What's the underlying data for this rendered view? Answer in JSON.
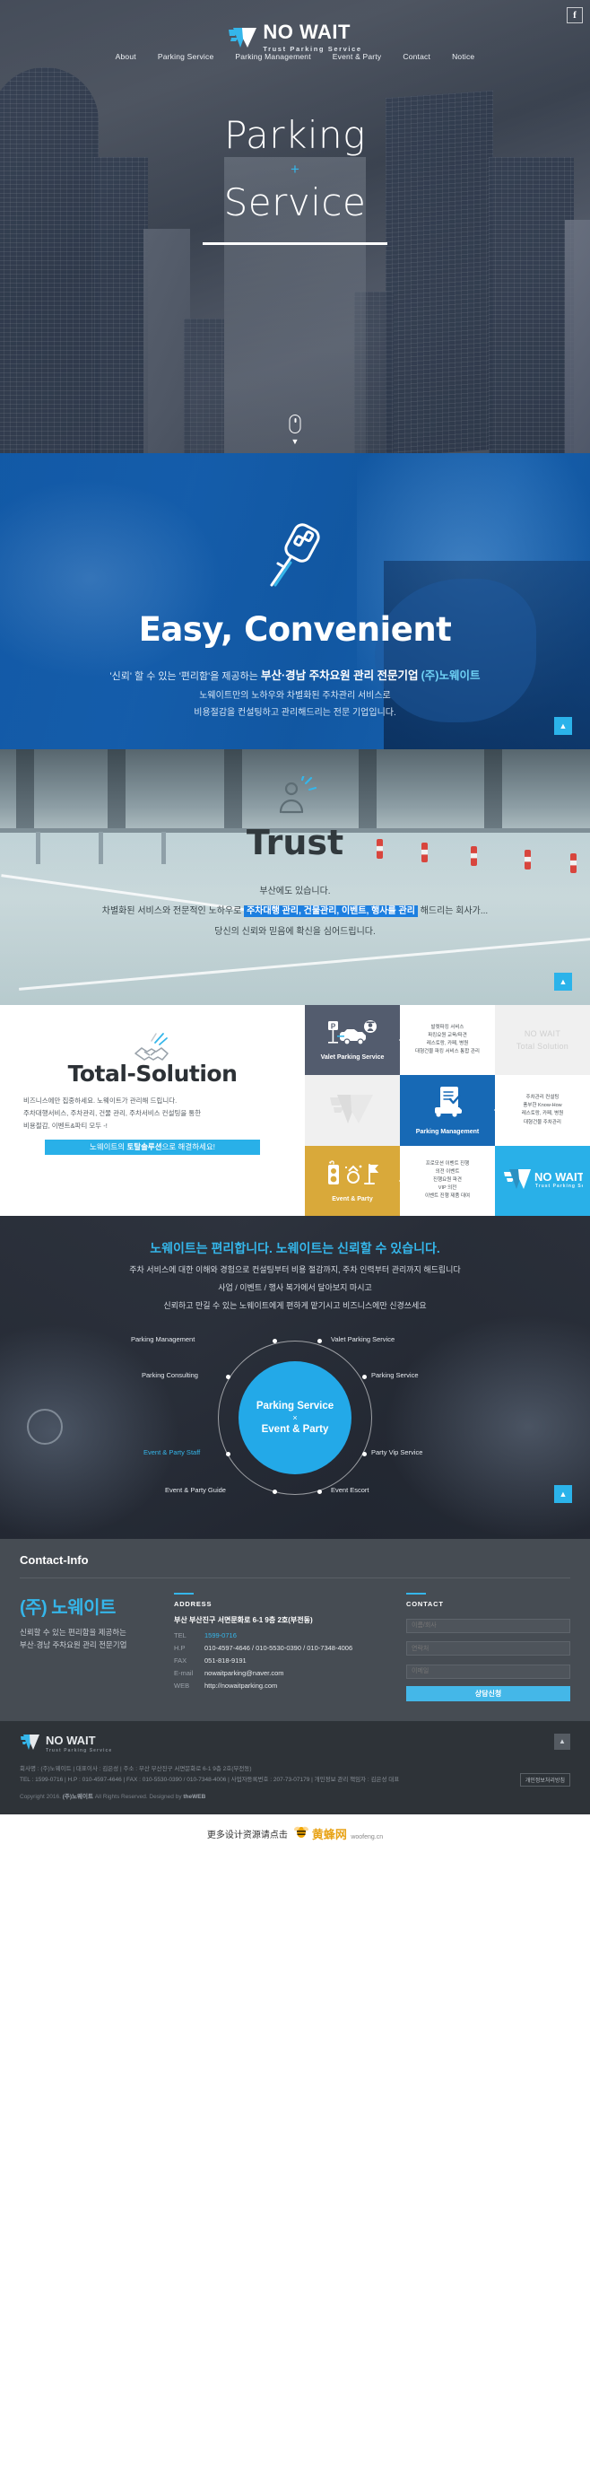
{
  "brand": {
    "name": "NO WAIT",
    "tagline": "Trust Parking Service",
    "facebook_icon": "f"
  },
  "nav": {
    "items": [
      {
        "label": "About"
      },
      {
        "label": "Parking Service"
      },
      {
        "label": "Parking Management"
      },
      {
        "label": "Event & Party"
      },
      {
        "label": "Contact"
      },
      {
        "label": "Notice"
      }
    ]
  },
  "hero": {
    "line1": "Parking",
    "plus": "+",
    "line2": "Service",
    "scroll_hint": "▼"
  },
  "easy": {
    "heading": "Easy, Convenient",
    "lead_prefix": "'신뢰' 할 수 있는 '편리함'을 제공하는 ",
    "lead_bold": "부산·경남 주차요원 관리 전문기업",
    "lead_cyan": "(주)노웨이트",
    "p1": "노웨이트만의 노하우와 차별화된 주차관리 서비스로",
    "p2": "비용절감을 컨설팅하고 관리해드리는 전문 기업입니다.",
    "scroll_top": "▲"
  },
  "trust": {
    "heading": "Trust",
    "l1": "부산에도 있습니다.",
    "l2_pre": "차별화된 서비스와 전문적인 노하우로 ",
    "l2_hl": "주차대행 관리, 건물관리, 이벤트, 행사를 관리",
    "l2_post": " 해드리는 회사가...",
    "l3": "당신의 신뢰와 믿음에 확신을 심어드립니다.",
    "scroll_top": "▲"
  },
  "total_solution": {
    "heading_a": "Total",
    "heading_dash": "-",
    "heading_b": "Solution",
    "p1": "비즈니스에만 집중하세요. 노웨이트가 관리해 드립니다.",
    "p2": "주차대행서비스, 주차관리, 건물 관리, 주차서비스 컨설팅을 통한",
    "p3": "비용절감, 이벤트&파티 모두 -!",
    "cta_pre": "노웨이트의 ",
    "cta_bold": "토탈솔루션",
    "cta_post": "으로 해결하세요!",
    "cells": {
      "valet_label": "Valet Parking Service",
      "valet_desc": [
        "발렛파킹 서비스",
        "파킹요원 교육/파견",
        "레스토랑, 카페, 병원",
        "대형건물 파킹 서비스 통합 관리"
      ],
      "watermark_a": "NO WAIT",
      "watermark_b": "Total  Solution",
      "pm_label": "Parking Management",
      "pm_desc": [
        "주차관리 컨설팅",
        "풍부한 Know-How",
        "레스토랑, 카페, 병원",
        "대형건물 주차관리"
      ],
      "ep_label": "Event & Party",
      "ep_desc": [
        "프로모션 이벤트 진행",
        "의전 이벤트",
        "진행요원 파견",
        "VIP 의전",
        "이벤트 진행 제품 대여"
      ]
    }
  },
  "diagram": {
    "heading": "노웨이트는 편리합니다. 노웨이트는 신뢰할 수 있습니다.",
    "p1": "주차 서비스에 대한 이해와 경험으로 컨설팅부터 비용 절감까지, 주차 인력부터 관리까지 해드립니다",
    "p2": "사업 / 이벤트 / 행사 복가에서 달아보지 마시고",
    "p3": "신뢰하고 만길 수 있는 노웨이트에게 편하게 맡기시고 비즈니스에만 신경쓰세요",
    "core_top": "Parking Service",
    "core_x": "×",
    "core_bottom": "Event & Party",
    "nodes": [
      {
        "label": "Parking Management"
      },
      {
        "label": "Valet Parking Service"
      },
      {
        "label": "Parking Service"
      },
      {
        "label": "Party Vip Service"
      },
      {
        "label": "Event Escort"
      },
      {
        "label": "Event & Party Guide"
      },
      {
        "label": "Event & Party Staff"
      },
      {
        "label": "Parking Consulting"
      }
    ],
    "scroll_top": "▲"
  },
  "contact": {
    "title": "Contact-Info",
    "brand_name": "(주) 노웨이트",
    "brand_p1": "신뢰할 수 있는 편리함을 제공하는",
    "brand_p2": "부산·경남 주차요원 관리 전문기업",
    "address_caption": "ADDRESS",
    "address": "부산 부산진구 서면문화로 6-1 9층 2호(부전동)",
    "rows": [
      {
        "key": "TEL",
        "value": "1599-0716",
        "accent": true
      },
      {
        "key": "H.P",
        "value": "010-4597-4646 / 010-5530-0390 / 010-7348-4006",
        "accent": false
      },
      {
        "key": "FAX",
        "value": "051-818-9191",
        "accent": false
      },
      {
        "key": "E-mail",
        "value": "nowaitparking@naver.com",
        "accent": false
      },
      {
        "key": "WEB",
        "value": "http://nowaitparking.com",
        "accent": false
      }
    ],
    "contact_caption": "CONTACT",
    "fields": [
      {
        "placeholder": "이름/회사",
        "value": ""
      },
      {
        "placeholder": "연락처",
        "value": ""
      },
      {
        "placeholder": "이메일",
        "value": ""
      }
    ],
    "submit_label": "상담신청"
  },
  "footer": {
    "logo_name": "NO WAIT",
    "logo_sub": "Trust Parking Service",
    "line1": "회사명 : (주)노웨이트  |  대표이사 : 김은성  |  주소 : 부산 부산진구 서면문화로 6-1 9층 2호(부전동)",
    "line2": "TEL : 1599-0716  |  H.P : 010-4597-4646  |  FAX : 010-5530-0390 / 010-7348-4006  |  사업자등록번호 : 207-73-07179  |  개인정보 관리 책임자 : 김은성 대표",
    "copyright_pre": "Copyright 2016. ",
    "copyright_bold": "(주)노웨이트",
    "copyright_post": " All Rights Reserved. Designed by ",
    "copyright_brand": "theWEB",
    "privacy_label": "개인정보처리방침",
    "to_top": "▲"
  },
  "banner": {
    "text": "更多设计资源请点击",
    "brand": "黄蜂网",
    "url": "woofeng.cn"
  },
  "colors": {
    "cyan": "#35b6ea",
    "blue": "#1769b5",
    "dark_slate": "#535c6e",
    "gold": "#d9a93a",
    "highlight_blue": "#1d7fe0",
    "footer_dark": "#2e3338",
    "contact_grey": "#464c53"
  }
}
